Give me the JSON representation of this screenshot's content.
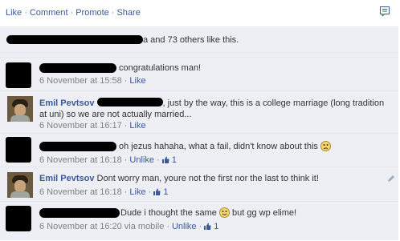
{
  "actions": {
    "like": "Like",
    "comment": "Comment",
    "promote": "Promote",
    "share": "Share"
  },
  "likes": {
    "text": "a and 73 others like this."
  },
  "comments": [
    {
      "text": "congratulations man!",
      "date": "6 November at 15:58",
      "like": "Like"
    },
    {
      "author": "Emil Pevtsov",
      "text": ", just by the way, this is a college marriage (long tradition at uni) so we are not actually married...",
      "date": "6 November at 16:17",
      "like": "Like"
    },
    {
      "text": "oh jezus hahaha, what a fail, didn't know about this",
      "date": "6 November at 16:18",
      "unlike": "Unlike",
      "count": "1"
    },
    {
      "author": "Emil Pevtsov",
      "text": "Dont worry man, youre not the first nor the last to think it!",
      "date": "6 November at 16:18",
      "like": "Like",
      "count": "1"
    },
    {
      "text": "Dude i thought the same",
      "text2": "but gg wp elime!",
      "date": "6 November at 16:20 via mobile",
      "unlike": "Unlike",
      "count": "1"
    }
  ]
}
